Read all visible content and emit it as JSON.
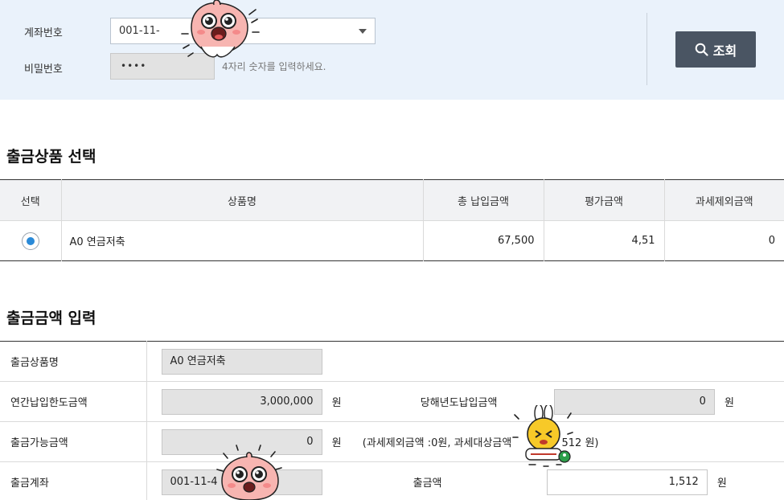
{
  "query": {
    "account_label": "계좌번호",
    "account_value": "001-11-",
    "password_label": "비밀번호",
    "password_value": "••••",
    "password_hint": "4자리 숫자를 입력하세요.",
    "search_button": "조회"
  },
  "product_section": {
    "title": "출금상품 선택",
    "headers": [
      "선택",
      "상품명",
      "총 납입금액",
      "평가금액",
      "과세제외금액"
    ],
    "rows": [
      {
        "product_name": "A0 연금저축",
        "total_paid": "67,500",
        "valuation": "4,51",
        "tax_exempt": "0"
      }
    ]
  },
  "amount_section": {
    "title": "출금금액 입력",
    "product_name_label": "출금상품명",
    "product_name_value": "A0 연금저축",
    "annual_limit_label": "연간납입한도금액",
    "annual_limit_value": "3,000,000",
    "current_year_paid_label": "당해년도납입금액",
    "current_year_paid_value": "0",
    "available_label": "출금가능금액",
    "available_value": "0",
    "available_note": "(과세제외금액 :0원, 과세대상금액",
    "available_note_tail": "512 원)",
    "account_label": "출금계좌",
    "account_value": "001-11-4",
    "withdraw_label": "출금액",
    "withdraw_value": "1,512",
    "unit": "원"
  },
  "colors": {
    "panel_bg": "#eaf2fb",
    "button_bg": "#4a5563",
    "radio_selected": "#2a8ad8"
  },
  "icons": {
    "search": "search-icon",
    "dropdown": "chevron-down-icon"
  }
}
